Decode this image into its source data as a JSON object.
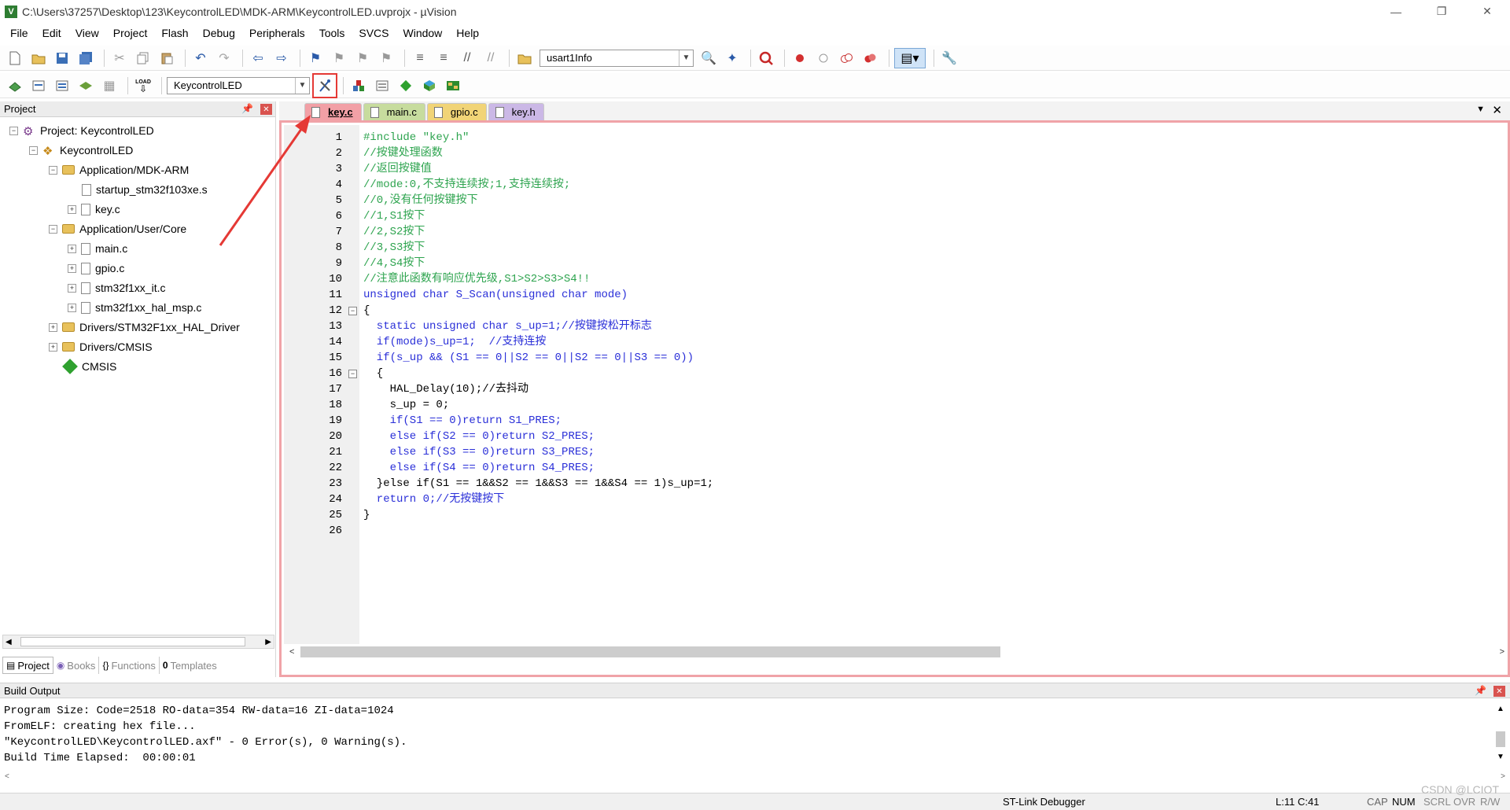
{
  "window": {
    "title": "C:\\Users\\37257\\Desktop\\123\\KeycontrolLED\\MDK-ARM\\KeycontrolLED.uvprojx - µVision",
    "app_icon_letter": "V",
    "minimize": "—",
    "restore": "❐",
    "close": "✕"
  },
  "menu": [
    "File",
    "Edit",
    "View",
    "Project",
    "Flash",
    "Debug",
    "Peripherals",
    "Tools",
    "SVCS",
    "Window",
    "Help"
  ],
  "toolbar1": {
    "find_combo_value": "usart1Info"
  },
  "toolbar2": {
    "load_label": "LOAD",
    "target_combo_value": "KeycontrolLED"
  },
  "project_panel": {
    "title": "Project",
    "tree": [
      {
        "label": "Project: KeycontrolLED",
        "kind": "project",
        "expander": "−"
      },
      {
        "label": "KeycontrolLED",
        "kind": "target",
        "expander": "−"
      },
      {
        "label": "Application/MDK-ARM",
        "kind": "folder",
        "expander": "−"
      },
      {
        "label": "startup_stm32f103xe.s",
        "kind": "file",
        "expander": ""
      },
      {
        "label": "key.c",
        "kind": "file",
        "expander": "+"
      },
      {
        "label": "Application/User/Core",
        "kind": "folder",
        "expander": "−"
      },
      {
        "label": "main.c",
        "kind": "file",
        "expander": "+"
      },
      {
        "label": "gpio.c",
        "kind": "file",
        "expander": "+"
      },
      {
        "label": "stm32f1xx_it.c",
        "kind": "file",
        "expander": "+"
      },
      {
        "label": "stm32f1xx_hal_msp.c",
        "kind": "file",
        "expander": "+"
      },
      {
        "label": "Drivers/STM32F1xx_HAL_Driver",
        "kind": "folder",
        "expander": "+"
      },
      {
        "label": "Drivers/CMSIS",
        "kind": "folder",
        "expander": "+"
      },
      {
        "label": "CMSIS",
        "kind": "cmsis",
        "expander": ""
      }
    ],
    "tabs": [
      {
        "label": "Project",
        "icon": "▤"
      },
      {
        "label": "Books",
        "icon": "◉"
      },
      {
        "label": "Functions",
        "icon": "{}"
      },
      {
        "label": "Templates",
        "icon": "0"
      }
    ]
  },
  "editor": {
    "tabs": [
      {
        "label": "key.c"
      },
      {
        "label": "main.c"
      },
      {
        "label": "gpio.c"
      },
      {
        "label": "key.h"
      }
    ],
    "lines": [
      "#include \"key.h\"",
      "//按键处理函数",
      "//返回按键值",
      "//mode:0,不支持连续按;1,支持连续按;",
      "//0,没有任何按键按下",
      "//1,S1按下",
      "//2,S2按下",
      "//3,S3按下",
      "//4,S4按下",
      "//注意此函数有响应优先级,S1>S2>S3>S4!!",
      "unsigned char S_Scan(unsigned char mode)",
      "{",
      "  static unsigned char s_up=1;//按键按松开标志",
      "  if(mode)s_up=1;  //支持连按",
      "  if(s_up && (S1 == 0||S2 == 0||S2 == 0||S3 == 0))",
      "  {",
      "    HAL_Delay(10);//去抖动",
      "    s_up = 0;",
      "    if(S1 == 0)return S1_PRES;",
      "    else if(S2 == 0)return S2_PRES;",
      "    else if(S3 == 0)return S3_PRES;",
      "    else if(S4 == 0)return S4_PRES;",
      "  }else if(S1 == 1&&S2 == 1&&S3 == 1&&S4 == 1)s_up=1;",
      "  return 0;//无按键按下",
      "}",
      ""
    ],
    "line_numbers": [
      "1",
      "2",
      "3",
      "4",
      "5",
      "6",
      "7",
      "8",
      "9",
      "10",
      "11",
      "12",
      "13",
      "14",
      "15",
      "16",
      "17",
      "18",
      "19",
      "20",
      "21",
      "22",
      "23",
      "24",
      "25",
      "26"
    ]
  },
  "build_output": {
    "title": "Build Output",
    "lines": [
      "Program Size: Code=2518 RO-data=354 RW-data=16 ZI-data=1024",
      "FromELF: creating hex file...",
      "\"KeycontrolLED\\KeycontrolLED.axf\" - 0 Error(s), 0 Warning(s).",
      "Build Time Elapsed:  00:00:01"
    ]
  },
  "status": {
    "debugger": "ST-Link Debugger",
    "position": "L:11 C:41",
    "cap": "CAP",
    "num": "NUM",
    "scrl": "SCRL",
    "ovr": "OVR",
    "raw": "R/W"
  },
  "watermark": "CSDN @LCIOT",
  "colors": {
    "tab_key_c": "#f2a0a6",
    "tab_main_c": "#c7dc9e",
    "tab_gpio_c": "#f1d477",
    "tab_key_h": "#cbb8e6",
    "comment_green": "#2ea44f",
    "keyword_blue": "#2a2fd8",
    "annotation_red": "#e53935"
  }
}
